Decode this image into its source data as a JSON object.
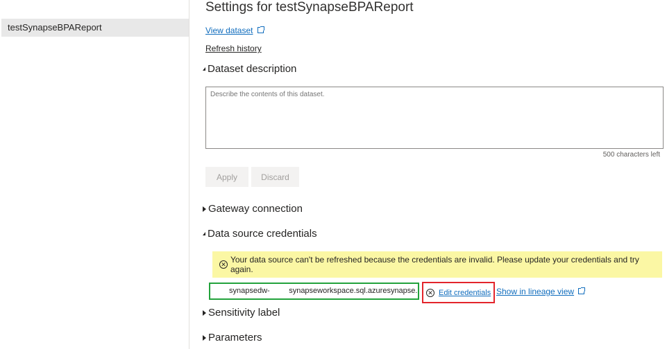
{
  "sidebar": {
    "items": [
      {
        "label": "testSynapseBPAReport",
        "selected": true
      }
    ]
  },
  "main": {
    "title": "Settings for testSynapseBPAReport",
    "view_dataset": "View dataset",
    "refresh_history": "Refresh history",
    "sections": {
      "dataset_description": "Dataset description",
      "gateway_connection": "Gateway connection",
      "data_source_credentials": "Data source credentials",
      "sensitivity_label": "Sensitivity label",
      "parameters": "Parameters"
    },
    "description": {
      "placeholder": "Describe the contents of this dataset.",
      "value": "",
      "chars_left": "500 characters left"
    },
    "buttons": {
      "apply": "Apply",
      "discard": "Discard"
    },
    "credentials": {
      "warning": "Your data source can't be refreshed because the credentials are invalid. Please update your credentials and try again.",
      "data_source": "synapsedw-         synapseworkspace.sql.azuresynapse.net",
      "edit_credentials": "Edit credentials",
      "show_lineage": "Show in lineage view"
    }
  },
  "colors": {
    "link": "#0f6cbd",
    "warning_bg": "#fbf7a4",
    "highlight_green": "#22a23b",
    "highlight_red": "#e3242b"
  }
}
